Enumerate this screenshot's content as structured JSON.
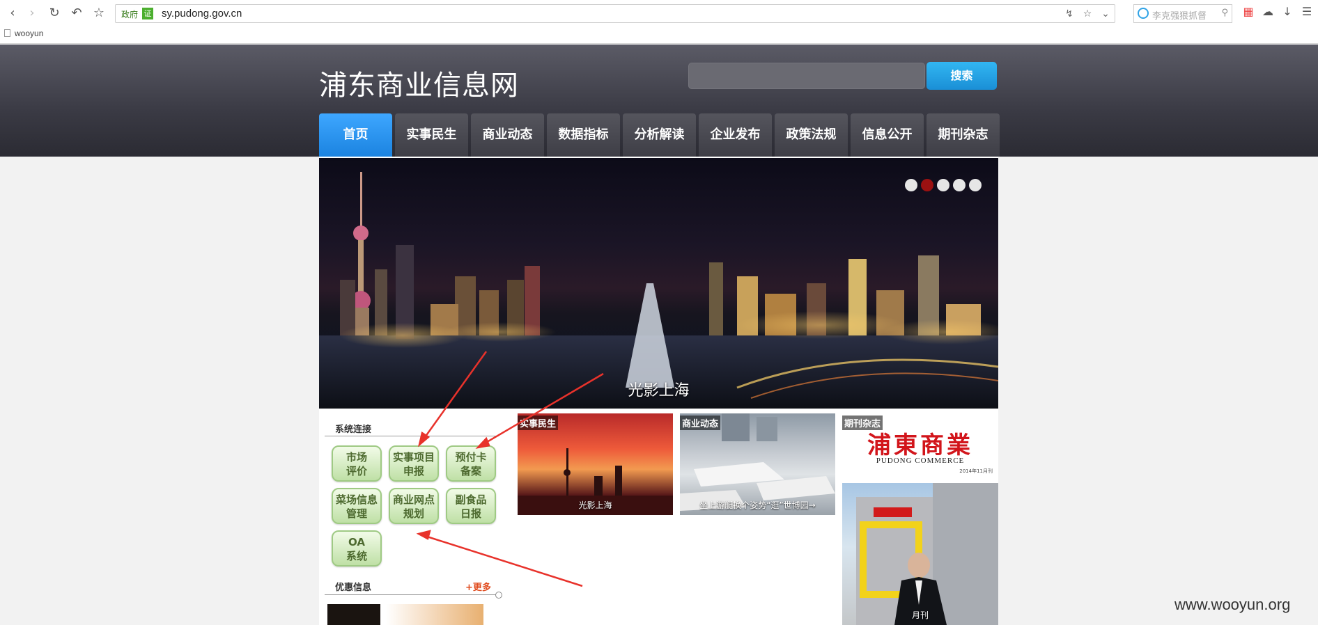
{
  "browser": {
    "gov_tag": "政府",
    "cert_badge": "证",
    "url": "sy.pudong.gov.cn",
    "search_placeholder": "李克强狠抓督",
    "bookmark": "wooyun"
  },
  "site": {
    "title": "浦东商业信息网",
    "search_button": "搜索",
    "nav": [
      {
        "label": "首页"
      },
      {
        "label": "实事民生"
      },
      {
        "label": "商业动态"
      },
      {
        "label": "数据指标"
      },
      {
        "label": "分析解读"
      },
      {
        "label": "企业发布"
      },
      {
        "label": "政策法规"
      },
      {
        "label": "信息公开"
      },
      {
        "label": "期刊杂志"
      }
    ]
  },
  "banner": {
    "caption": "光影上海",
    "active_slide": 2,
    "slide_count": 5
  },
  "system_links": {
    "title": "系统连接",
    "buttons": [
      {
        "line1": "市场",
        "line2": "评价"
      },
      {
        "line1": "实事项目",
        "line2": "申报"
      },
      {
        "line1": "预付卡",
        "line2": "备案"
      },
      {
        "line1": "菜场信息",
        "line2": "管理"
      },
      {
        "line1": "商业网点",
        "line2": "规划"
      },
      {
        "line1": "副食品",
        "line2": "日报"
      },
      {
        "line1": "OA",
        "line2": "系统"
      }
    ]
  },
  "offers": {
    "title": "优惠信息",
    "more": "+更多"
  },
  "tiles": [
    {
      "tag": "实事民生",
      "caption": "光影上海"
    },
    {
      "tag": "商业动态",
      "caption": "坐上游艇换个姿势“逛”世博园→"
    },
    {
      "tag": "期刊杂志",
      "caption": "月刊"
    }
  ],
  "magazine": {
    "title_cn": "浦東商業",
    "title_en": "PUDONG COMMERCE",
    "issue": "2014年11月刊"
  },
  "watermark": "www.wooyun.org",
  "colors": {
    "nav_active": "#1b83e0",
    "search_button": "#1a8fd6",
    "button_green": "#bfe0a6",
    "annotation_red": "#e8322b"
  }
}
